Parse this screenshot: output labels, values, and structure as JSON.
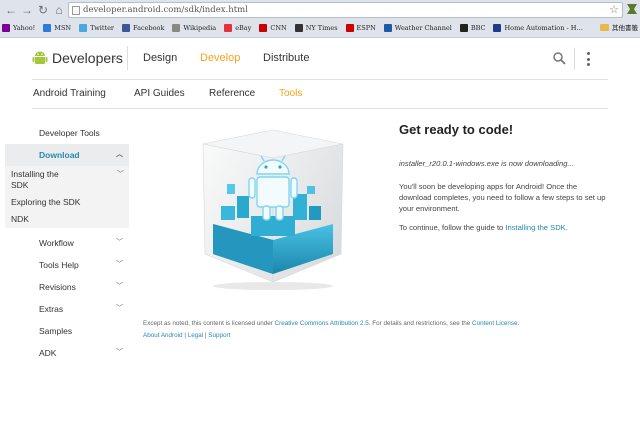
{
  "browser": {
    "url": "developer.android.com/sdk/index.html",
    "bookmarks": [
      {
        "label": "Yahoo!",
        "color": "#7b0099"
      },
      {
        "label": "MSN",
        "color": "#2b7bd8"
      },
      {
        "label": "Twitter",
        "color": "#4aa8e0"
      },
      {
        "label": "Facebook",
        "color": "#3b5998"
      },
      {
        "label": "Wikipedia",
        "color": "#888888"
      },
      {
        "label": "eBay",
        "color": "#e53238"
      },
      {
        "label": "CNN",
        "color": "#cc0000"
      },
      {
        "label": "NY Times",
        "color": "#333333"
      },
      {
        "label": "ESPN",
        "color": "#cc0000"
      },
      {
        "label": "Weather Channel",
        "color": "#1e5aa8"
      },
      {
        "label": "BBC",
        "color": "#222222"
      },
      {
        "label": "Home Automation - H…",
        "color": "#1e3c8c"
      }
    ],
    "other_bookmarks": "其他書籤"
  },
  "header": {
    "brand": "Developers",
    "nav": [
      "Design",
      "Develop",
      "Distribute"
    ],
    "active_nav": "Develop"
  },
  "subnav": {
    "items": [
      "Android Training",
      "API Guides",
      "Reference",
      "Tools"
    ],
    "active": "Tools"
  },
  "sidebar": {
    "items": [
      {
        "label": "Developer Tools"
      },
      {
        "label": "Download"
      },
      {
        "label": "Installing the SDK"
      },
      {
        "label": "Exploring the SDK"
      },
      {
        "label": "NDK"
      },
      {
        "label": "Workflow"
      },
      {
        "label": "Tools Help"
      },
      {
        "label": "Revisions"
      },
      {
        "label": "Extras"
      },
      {
        "label": "Samples"
      },
      {
        "label": "ADK"
      }
    ]
  },
  "main": {
    "title": "Get ready to code!",
    "downloading": "installer_r20.0.1-windows.exe is now downloading...",
    "para1": "You'll soon be developing apps for Android! Once the download completes, you need to follow a few steps to set up your environment.",
    "para2_prefix": "To continue, follow the guide to ",
    "para2_link": "Installing the SDK",
    "para2_suffix": "."
  },
  "footer": {
    "line1_prefix": "Except as noted, this content is licensed under ",
    "license_link": "Creative Commons Attribution 2.5",
    "line1_middle": ". For details and restrictions, see the ",
    "content_license_link": "Content License",
    "line1_suffix": ".",
    "links": [
      "About Android",
      "Legal",
      "Support"
    ],
    "separator": "|"
  },
  "colors": {
    "accent": "#f5a41b",
    "link": "#258aaf",
    "android_green": "#a4c639",
    "cube_blue": "#2aa9cf"
  }
}
